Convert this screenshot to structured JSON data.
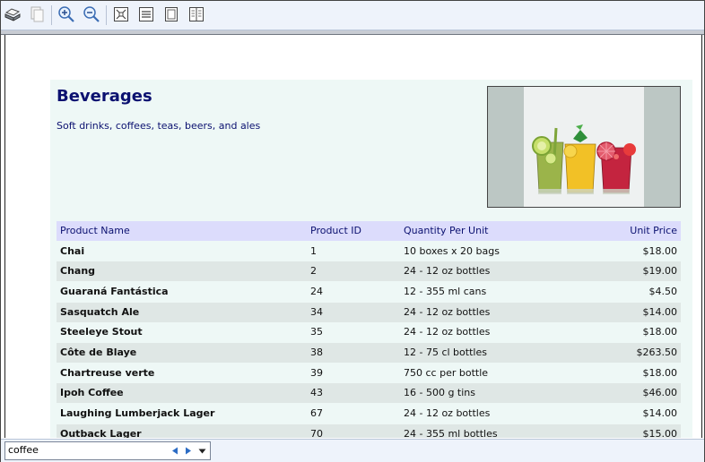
{
  "toolbar": {
    "buttons": [
      {
        "name": "print-icon"
      },
      {
        "name": "copy-icon"
      },
      {
        "name": "zoom-in-icon"
      },
      {
        "name": "zoom-out-icon"
      },
      {
        "name": "fit-page-icon"
      },
      {
        "name": "fit-width-icon"
      },
      {
        "name": "single-page-icon"
      },
      {
        "name": "two-page-icon"
      }
    ]
  },
  "report": {
    "category_title": "Beverages",
    "category_description": "Soft drinks, coffees, teas, beers, and ales",
    "image_name": "beverages-photo",
    "table": {
      "headers": {
        "name": "Product Name",
        "id": "Product ID",
        "qty": "Quantity Per Unit",
        "price": "Unit Price"
      },
      "rows": [
        {
          "name": "Chai",
          "id": "1",
          "qty": "10 boxes x 20 bags",
          "price": "$18.00"
        },
        {
          "name": "Chang",
          "id": "2",
          "qty": "24 - 12 oz bottles",
          "price": "$19.00"
        },
        {
          "name": "Guaraná Fantástica",
          "id": "24",
          "qty": "12 - 355 ml cans",
          "price": "$4.50"
        },
        {
          "name": "Sasquatch Ale",
          "id": "34",
          "qty": "24 - 12 oz bottles",
          "price": "$14.00"
        },
        {
          "name": "Steeleye Stout",
          "id": "35",
          "qty": "24 - 12 oz bottles",
          "price": "$18.00"
        },
        {
          "name": "Côte de Blaye",
          "id": "38",
          "qty": "12 - 75 cl bottles",
          "price": "$263.50"
        },
        {
          "name": "Chartreuse verte",
          "id": "39",
          "qty": "750 cc per bottle",
          "price": "$18.00"
        },
        {
          "name": "Ipoh Coffee",
          "id": "43",
          "qty": "16 - 500 g tins",
          "price": "$46.00"
        },
        {
          "name": "Laughing Lumberjack Lager",
          "id": "67",
          "qty": "24 - 12 oz bottles",
          "price": "$14.00"
        },
        {
          "name": "Outback Lager",
          "id": "70",
          "qty": "24 - 355 ml bottles",
          "price": "$15.00"
        }
      ]
    }
  },
  "search": {
    "value": "coffee"
  },
  "colors": {
    "title": "#0b1170",
    "header_bg": "#dcdcfc",
    "row_even": "#eef8f6",
    "row_odd": "#dfe7e5"
  }
}
